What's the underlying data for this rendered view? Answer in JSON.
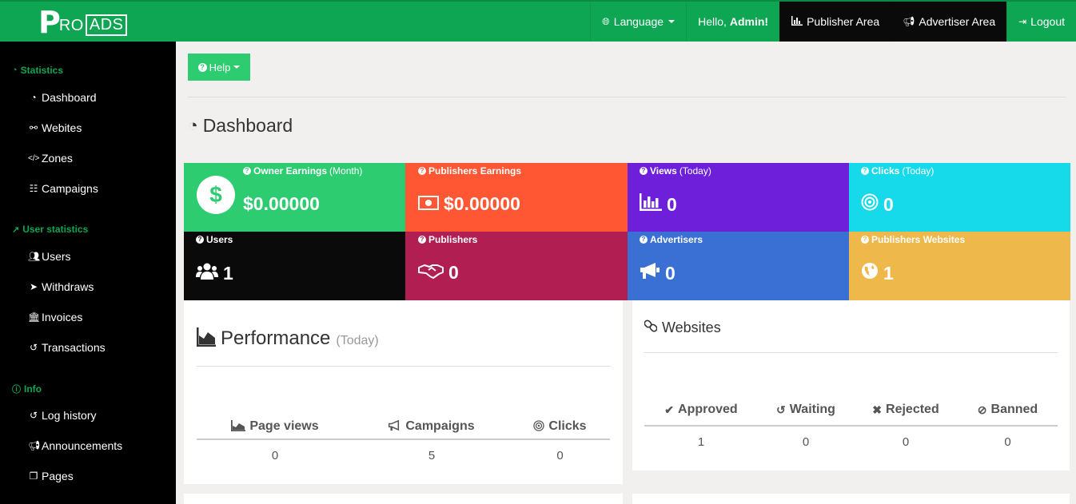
{
  "brand": {
    "logo_p": "P",
    "logo_ro": "RO",
    "logo_ads": "ADS"
  },
  "topnav": {
    "language": "Language",
    "hello": "Hello,",
    "user": "Admin!",
    "publisher_area": "Publisher Area",
    "advertiser_area": "Advertiser Area",
    "logout": "Logout"
  },
  "sidebar": {
    "sections": [
      {
        "title": "Statistics",
        "icon": "dashboard-icon",
        "items": [
          {
            "label": "Dashboard",
            "icon": "dashboard-icon"
          },
          {
            "label": "Webites",
            "icon": "link-icon"
          },
          {
            "label": "Zones",
            "icon": "code-icon"
          },
          {
            "label": "Campaigns",
            "icon": "database-icon"
          }
        ]
      },
      {
        "title": "User statistics",
        "icon": "line-chart-icon",
        "items": [
          {
            "label": "Users",
            "icon": "users-icon"
          },
          {
            "label": "Withdraws",
            "icon": "send-icon"
          },
          {
            "label": "Invoices",
            "icon": "bank-icon"
          },
          {
            "label": "Transactions",
            "icon": "history-icon"
          }
        ]
      },
      {
        "title": "Info",
        "icon": "info-icon",
        "items": [
          {
            "label": "Log history",
            "icon": "history-icon"
          },
          {
            "label": "Announcements",
            "icon": "bullhorn-icon"
          },
          {
            "label": "Pages",
            "icon": "copy-icon"
          }
        ]
      }
    ]
  },
  "help": {
    "label": "Help"
  },
  "page": {
    "title": "Dashboard"
  },
  "tiles": [
    {
      "label": "Owner Earnings",
      "sub": "(Month)",
      "value": "$0.00000",
      "color": "#2ecc71",
      "icon": "dollar-icon"
    },
    {
      "label": "Publishers Earnings",
      "sub": "",
      "value": "$0.00000",
      "color": "#ff5733",
      "icon": "money-icon"
    },
    {
      "label": "Views",
      "sub": "(Today)",
      "value": "0",
      "color": "#6d1fd9",
      "icon": "bar-chart-icon"
    },
    {
      "label": "Clicks",
      "sub": "(Today)",
      "value": "0",
      "color": "#16d9ea",
      "icon": "bullseye-icon"
    },
    {
      "label": "Users",
      "sub": "",
      "value": "1",
      "color": "#0a0a0a",
      "icon": "users-icon"
    },
    {
      "label": "Publishers",
      "sub": "",
      "value": "0",
      "color": "#b01e52",
      "icon": "handshake-icon"
    },
    {
      "label": "Advertisers",
      "sub": "",
      "value": "0",
      "color": "#3a6fd4",
      "icon": "bullhorn-icon"
    },
    {
      "label": "Publishers Websites",
      "sub": "",
      "value": "1",
      "color": "#efb84a",
      "icon": "globe-icon"
    }
  ],
  "performance": {
    "title": "Performance",
    "sub": "(Today)",
    "headers": [
      "Page views",
      "Campaigns",
      "Clicks"
    ],
    "values": [
      "0",
      "5",
      "0"
    ]
  },
  "websites": {
    "title": "Websites",
    "headers": [
      "Approved",
      "Waiting",
      "Rejected",
      "Banned"
    ],
    "values": [
      "1",
      "0",
      "0",
      "0"
    ]
  }
}
